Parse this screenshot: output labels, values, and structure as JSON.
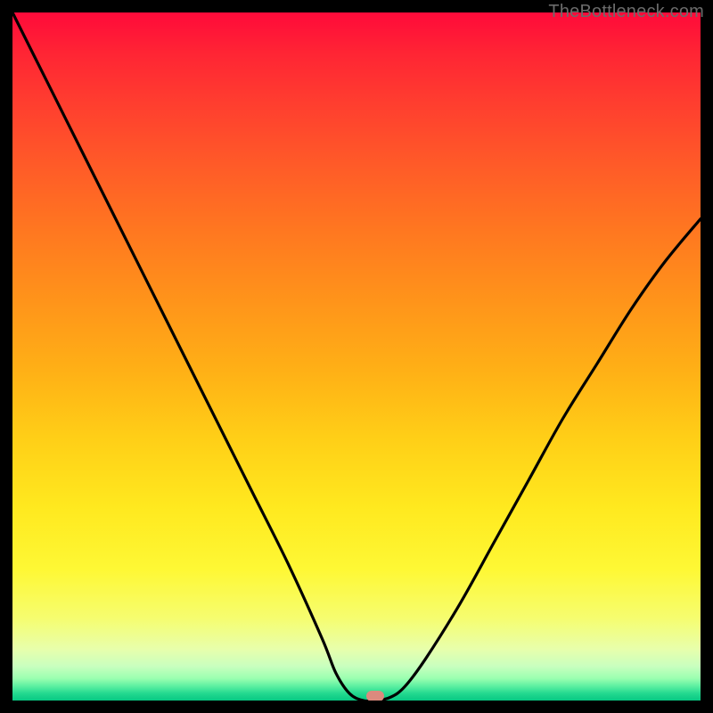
{
  "watermark": "TheBottleneck.com",
  "colors": {
    "background": "#000000",
    "curve": "#000000",
    "marker": "#dc8a7e",
    "watermark": "#6b6b6b"
  },
  "marker": {
    "x_pct": 52.7,
    "y_pct": 99.3
  },
  "chart_data": {
    "type": "line",
    "title": "",
    "xlabel": "",
    "ylabel": "",
    "xlim": [
      0,
      100
    ],
    "ylim": [
      0,
      100
    ],
    "grid": false,
    "series": [
      {
        "name": "bottleneck-curve",
        "x": [
          0,
          5,
          10,
          15,
          20,
          25,
          30,
          35,
          40,
          45,
          47,
          49,
          51,
          53,
          55,
          57,
          60,
          65,
          70,
          75,
          80,
          85,
          90,
          95,
          100
        ],
        "y": [
          100,
          90,
          80,
          70,
          60,
          50,
          40,
          30,
          20,
          9,
          4,
          1,
          0,
          0,
          0.5,
          2,
          6,
          14,
          23,
          32,
          41,
          49,
          57,
          64,
          70
        ]
      }
    ],
    "annotations": [
      {
        "type": "marker",
        "x": 52.7,
        "y": 0.7,
        "shape": "pill",
        "color": "#dc8a7e"
      }
    ],
    "background_gradient": {
      "direction": "vertical",
      "stops": [
        {
          "pct": 0,
          "color": "#ff0a3a"
        },
        {
          "pct": 22,
          "color": "#ff5a28"
        },
        {
          "pct": 52,
          "color": "#ffb016"
        },
        {
          "pct": 81,
          "color": "#fef835"
        },
        {
          "pct": 95,
          "color": "#c9ffbf"
        },
        {
          "pct": 100,
          "color": "#08c883"
        }
      ]
    }
  }
}
